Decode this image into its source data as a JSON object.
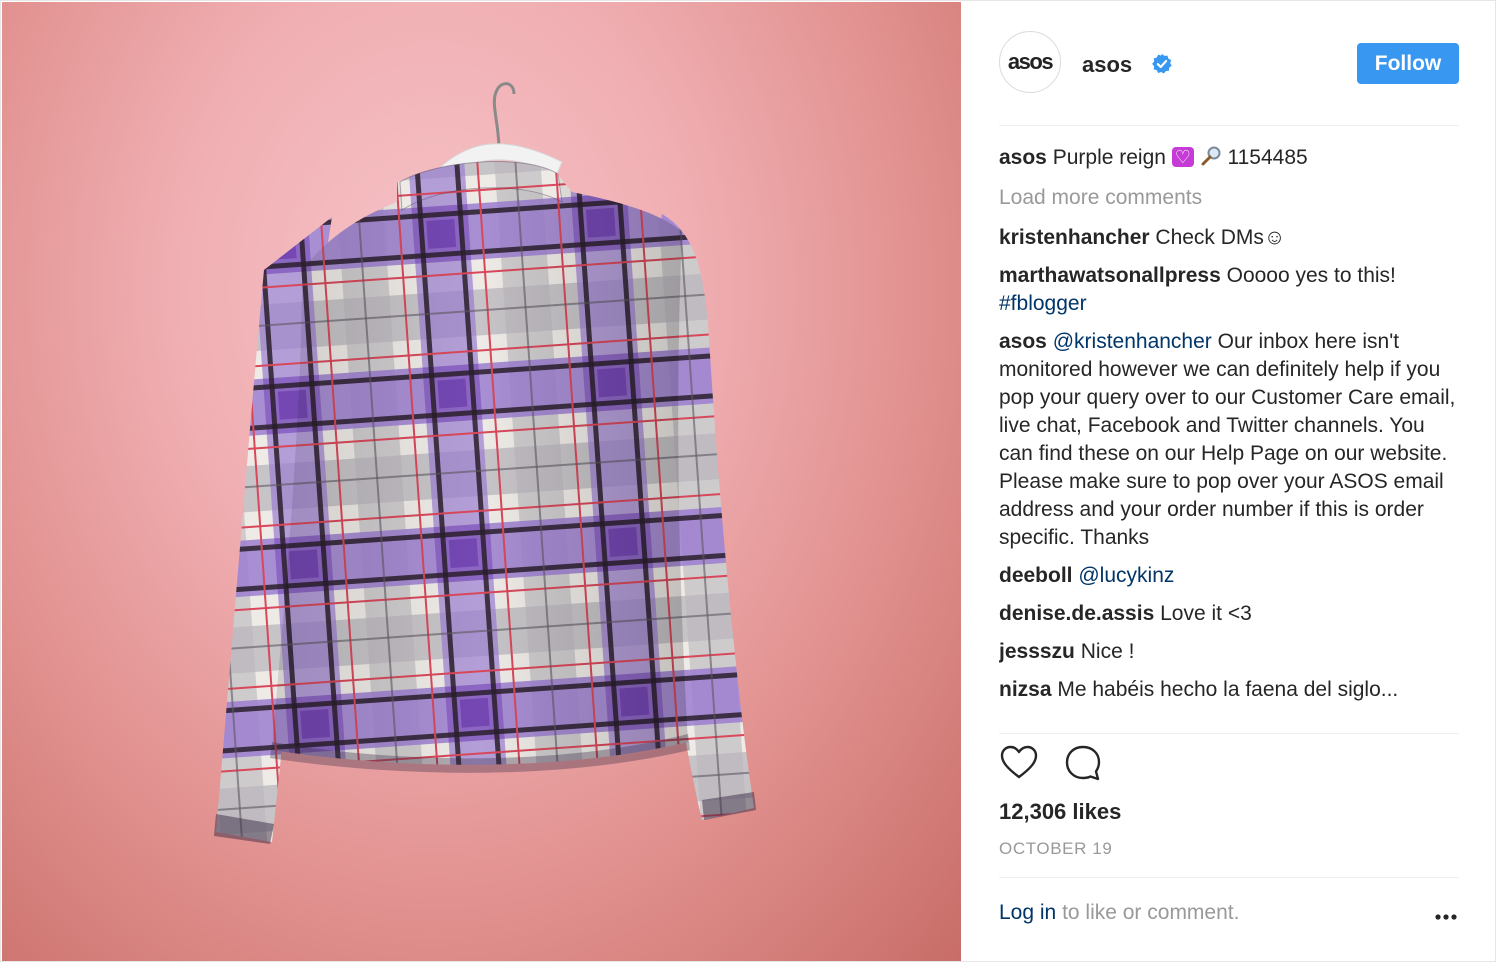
{
  "account": {
    "avatar_text": "asos",
    "username": "asos",
    "verified": true,
    "follow_label": "Follow"
  },
  "caption": {
    "user": "asos",
    "text": "Purple reign",
    "emoji": "purple-heart",
    "search_emoji": "magnifier",
    "code": "1154485"
  },
  "load_more_label": "Load more comments",
  "comments": [
    {
      "user": "kristenhancher",
      "text": "Check DMs☺"
    },
    {
      "user": "marthawatsonallpress",
      "text": "Ooooo yes to this!",
      "hashtag": "#fblogger"
    },
    {
      "user": "asos",
      "mention": "@kristenhancher",
      "text": "Our inbox here isn't monitored however we can definitely help if you pop your query over to our Customer Care email, live chat, Facebook and Twitter channels. You can find these on our Help Page on our website. Please make sure to pop over your ASOS email address and your order number if this is order specific. Thanks"
    },
    {
      "user": "deeboll",
      "mention": "@lucykinz"
    },
    {
      "user": "denise.de.assis",
      "text": "Love it <3"
    },
    {
      "user": "jessszu",
      "text": "Nice !"
    },
    {
      "user": "nizsa",
      "text": "Me habéis hecho la faena del siglo..."
    }
  ],
  "actions": {
    "like_icon": "heart-outline-icon",
    "comment_icon": "speech-bubble-icon"
  },
  "likes": "12,306 likes",
  "date": "OCTOBER 19",
  "footer": {
    "login_label": "Log in",
    "rest": "to like or comment.",
    "more_icon": "ellipsis-icon"
  },
  "colors": {
    "follow_blue": "#3897f0",
    "link_blue": "#003569",
    "muted": "#999999",
    "photo_background": "#f0aeb2",
    "plaid_purple": "#7b4fb8"
  }
}
